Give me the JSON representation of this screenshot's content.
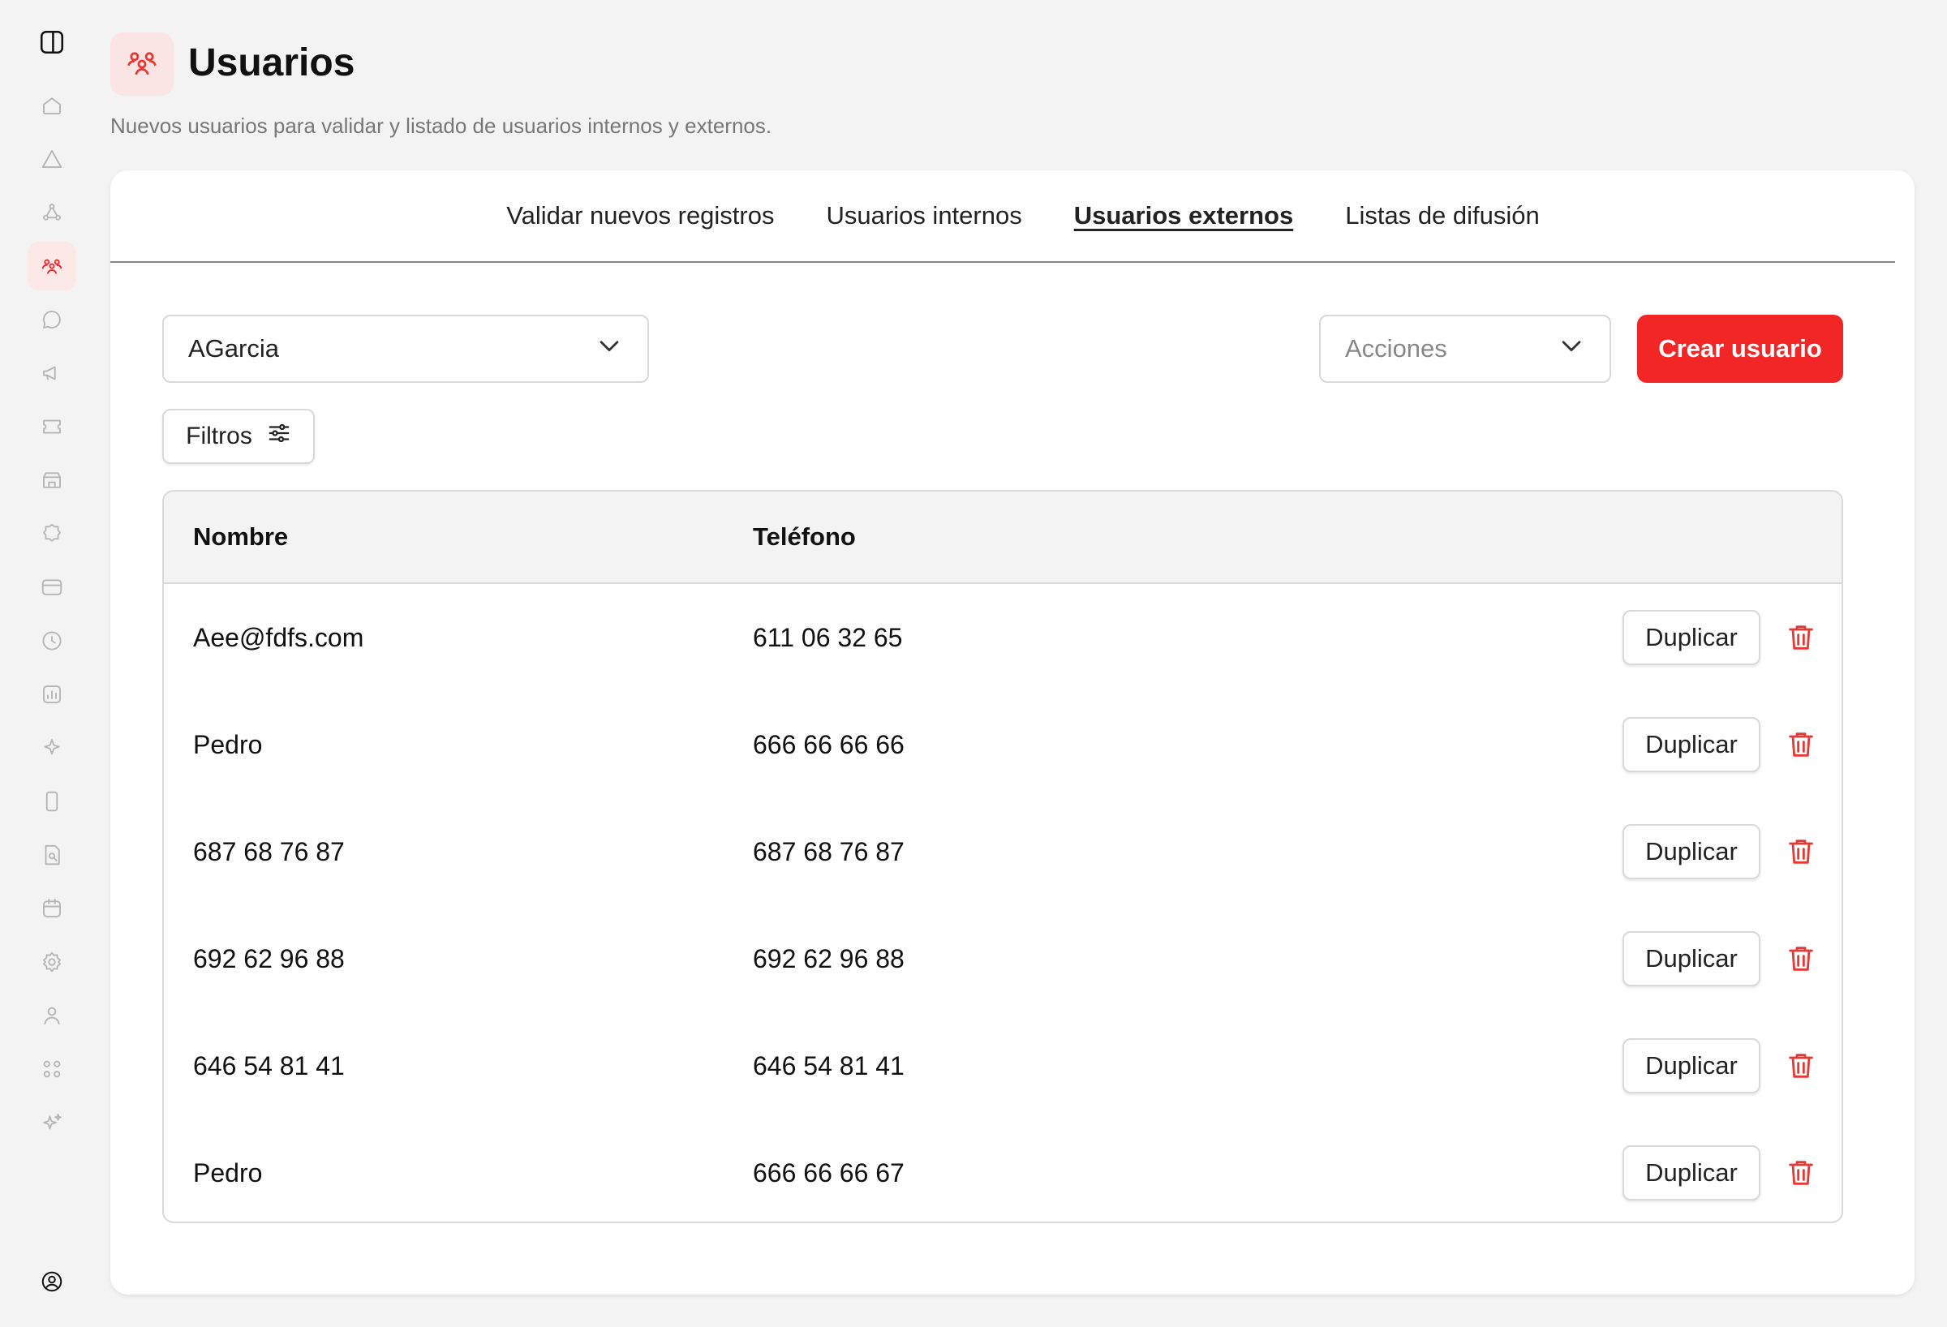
{
  "sidebar": {
    "toggle_icon": "panel-toggle-icon",
    "items": [
      {
        "icon": "home-icon",
        "active": false
      },
      {
        "icon": "alert-icon",
        "active": false
      },
      {
        "icon": "network-icon",
        "active": false
      },
      {
        "icon": "users-icon",
        "active": true
      },
      {
        "icon": "chat-icon",
        "active": false
      },
      {
        "icon": "megaphone-icon",
        "active": false
      },
      {
        "icon": "ticket-icon",
        "active": false
      },
      {
        "icon": "store-icon",
        "active": false
      },
      {
        "icon": "badge-icon",
        "active": false
      },
      {
        "icon": "card-icon",
        "active": false
      },
      {
        "icon": "clock-icon",
        "active": false
      },
      {
        "icon": "chart-icon",
        "active": false
      },
      {
        "icon": "sparkle-icon",
        "active": false
      },
      {
        "icon": "phone-icon",
        "active": false
      },
      {
        "icon": "document-search-icon",
        "active": false
      },
      {
        "icon": "calendar-icon",
        "active": false
      },
      {
        "icon": "settings-icon",
        "active": false
      },
      {
        "icon": "user-icon",
        "active": false
      },
      {
        "icon": "apps-icon",
        "active": false
      },
      {
        "icon": "sparkles-icon",
        "active": false
      }
    ],
    "profile_icon": "profile-icon",
    "accent_color": "#f32626"
  },
  "header": {
    "title": "Usuarios",
    "subtitle": "Nuevos usuarios para validar y listado de usuarios internos y externos.",
    "icon": "users-icon"
  },
  "tabs": [
    {
      "label": "Validar nuevos registros",
      "active": false
    },
    {
      "label": "Usuarios internos",
      "active": false
    },
    {
      "label": "Usuarios externos",
      "active": true
    },
    {
      "label": "Listas de difusión",
      "active": false
    }
  ],
  "toolbar": {
    "user_select_value": "AGarcia",
    "actions_placeholder": "Acciones",
    "create_label": "Crear usuario",
    "filters_label": "Filtros"
  },
  "table": {
    "columns": [
      "Nombre",
      "Teléfono"
    ],
    "duplicate_label": "Duplicar",
    "rows": [
      {
        "nombre": "Aee@fdfs.com",
        "telefono": "611 06 32 65"
      },
      {
        "nombre": "Pedro",
        "telefono": "666 66 66 66"
      },
      {
        "nombre": "687 68 76 87",
        "telefono": "687 68 76 87"
      },
      {
        "nombre": "692 62 96 88",
        "telefono": "692 62 96 88"
      },
      {
        "nombre": "646 54 81 41",
        "telefono": "646 54 81 41"
      },
      {
        "nombre": "Pedro",
        "telefono": "666 66 66 67"
      }
    ]
  }
}
